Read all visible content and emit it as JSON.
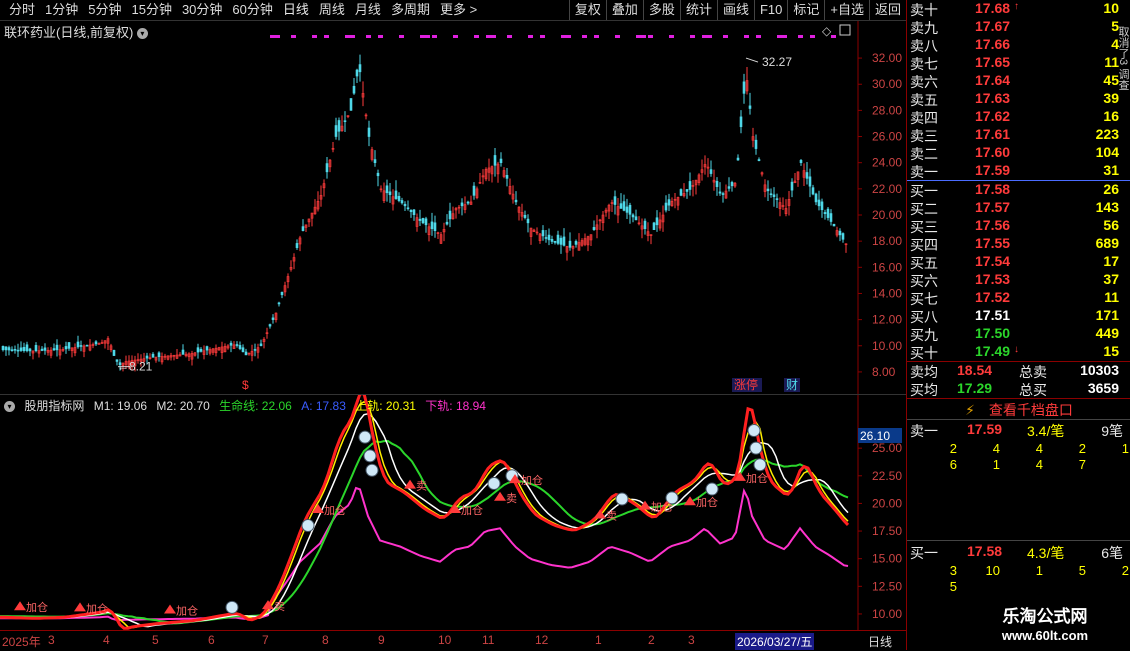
{
  "toolbar": {
    "periods": [
      "分时",
      "1分钟",
      "5分钟",
      "15分钟",
      "30分钟",
      "60分钟",
      "日线",
      "周线",
      "月线",
      "多周期",
      "更多 >"
    ],
    "active_period": "日线",
    "buttons": [
      "复权",
      "叠加",
      "多股",
      "统计",
      "画线",
      "F10",
      "标记",
      "+自选",
      "返回"
    ]
  },
  "stock": {
    "title": "联环药业(日线,前复权)",
    "high_marker": "32.27",
    "low_marker": "8.21",
    "badges": [
      "$",
      "涨停",
      "财"
    ]
  },
  "price_axis": [
    "32.00",
    "30.00",
    "28.00",
    "26.00",
    "24.00",
    "22.00",
    "20.00",
    "18.00",
    "16.00",
    "14.00",
    "12.00",
    "10.00",
    "8.00"
  ],
  "indicator": {
    "name": "股朋指标网",
    "m1_label": "M1: 19.06",
    "m2_label": "M2: 20.70",
    "life_label": "生命线: 22.06",
    "a_label": "A: 17.83",
    "upper_label": "上轨: 20.31",
    "lower_label": "下轨: 18.94",
    "current_value": "26.10",
    "axis": [
      "25.00",
      "22.50",
      "20.00",
      "17.50",
      "15.00",
      "12.50",
      "10.00"
    ],
    "signal_labels": [
      "加仓",
      "加仓",
      "加仓",
      "卖",
      "加仓",
      "卖",
      "加仓",
      "卖",
      "加仓",
      "卖",
      "加仓",
      "加仓",
      "加仓"
    ]
  },
  "dates": [
    "2025年",
    "3",
    "4",
    "5",
    "6",
    "7",
    "8",
    "9",
    "10",
    "11",
    "12",
    "1",
    "2",
    "3",
    "2026/03/27/五"
  ],
  "period_label": "日线",
  "orderbook": {
    "sells": [
      {
        "label": "卖十",
        "price": "17.68",
        "vol": "10",
        "price_color": "red"
      },
      {
        "label": "卖九",
        "price": "17.67",
        "vol": "5",
        "price_color": "red"
      },
      {
        "label": "卖八",
        "price": "17.66",
        "vol": "4",
        "price_color": "red"
      },
      {
        "label": "卖七",
        "price": "17.65",
        "vol": "11",
        "price_color": "red"
      },
      {
        "label": "卖六",
        "price": "17.64",
        "vol": "45",
        "price_color": "red"
      },
      {
        "label": "卖五",
        "price": "17.63",
        "vol": "39",
        "price_color": "red"
      },
      {
        "label": "卖四",
        "price": "17.62",
        "vol": "16",
        "price_color": "red"
      },
      {
        "label": "卖三",
        "price": "17.61",
        "vol": "223",
        "price_color": "red"
      },
      {
        "label": "卖二",
        "price": "17.60",
        "vol": "104",
        "price_color": "red"
      },
      {
        "label": "卖一",
        "price": "17.59",
        "vol": "31",
        "price_color": "red"
      }
    ],
    "buys": [
      {
        "label": "买一",
        "price": "17.58",
        "vol": "26",
        "price_color": "red"
      },
      {
        "label": "买二",
        "price": "17.57",
        "vol": "143",
        "price_color": "red"
      },
      {
        "label": "买三",
        "price": "17.56",
        "vol": "56",
        "price_color": "red"
      },
      {
        "label": "买四",
        "price": "17.55",
        "vol": "689",
        "price_color": "red"
      },
      {
        "label": "买五",
        "price": "17.54",
        "vol": "17",
        "price_color": "red"
      },
      {
        "label": "买六",
        "price": "17.53",
        "vol": "37",
        "price_color": "red"
      },
      {
        "label": "买七",
        "price": "17.52",
        "vol": "11",
        "price_color": "red"
      },
      {
        "label": "买八",
        "price": "17.51",
        "vol": "171",
        "price_color": "white"
      },
      {
        "label": "买九",
        "price": "17.50",
        "vol": "449",
        "price_color": "green"
      },
      {
        "label": "买十",
        "price": "17.49",
        "vol": "15",
        "price_color": "green"
      }
    ],
    "sell_avg_label": "卖均",
    "sell_avg": "18.54",
    "total_sell_label": "总卖",
    "total_sell": "10303",
    "buy_avg_label": "买均",
    "buy_avg": "17.29",
    "total_buy_label": "总买",
    "total_buy": "3659"
  },
  "depth": {
    "link_label": "查看千档盘口",
    "sell1_label": "卖一",
    "sell1_price": "17.59",
    "sell1_avg": "3.4/笔",
    "sell1_count": "9笔",
    "sell1_queue": [
      "2",
      "4",
      "4",
      "2",
      "1",
      "6",
      "1",
      "4",
      "7"
    ],
    "buy1_label": "买一",
    "buy1_price": "17.58",
    "buy1_avg": "4.3/笔",
    "buy1_count": "6笔",
    "buy1_queue": [
      "3",
      "10",
      "1",
      "5",
      "2",
      "5"
    ]
  },
  "side_text": "取消了3 调查",
  "watermark": {
    "line1": "乐淘公式网",
    "line2": "www.60lt.com"
  }
}
